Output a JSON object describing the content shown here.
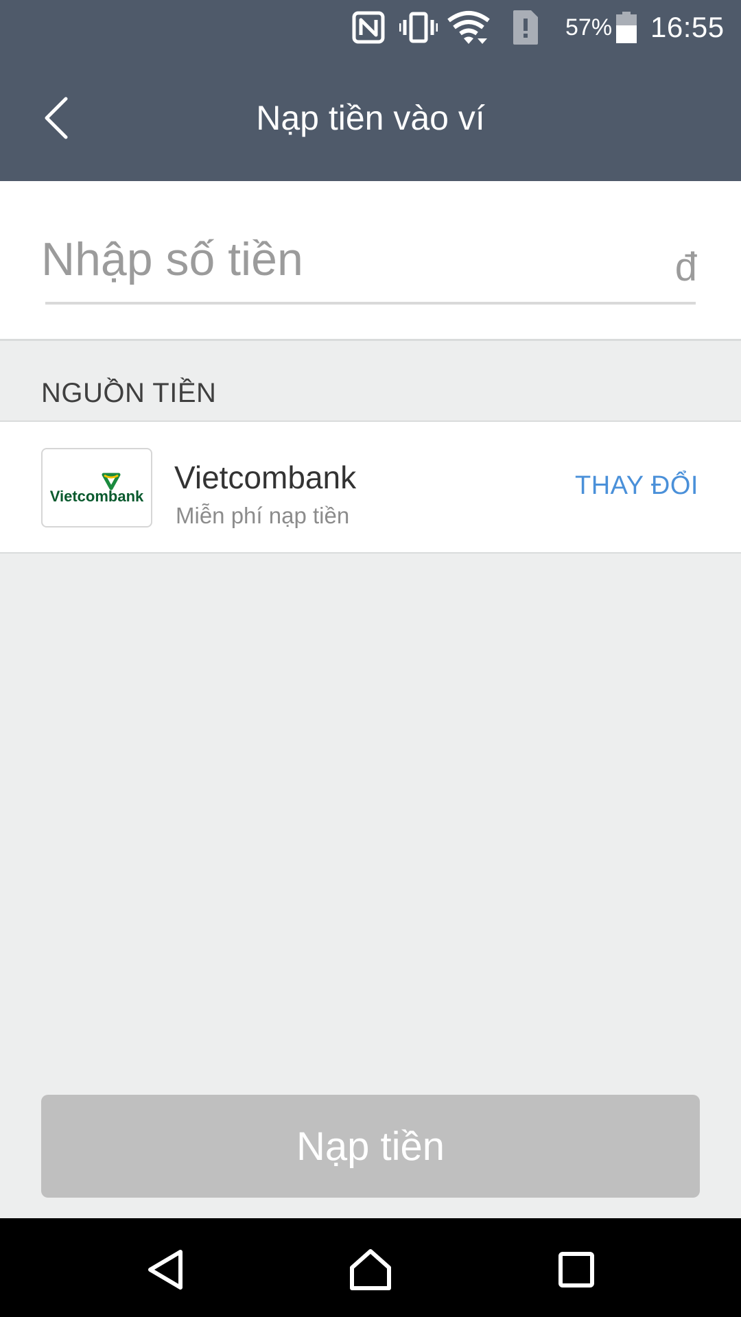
{
  "status_bar": {
    "battery_percent": "57%",
    "time": "16:55",
    "icons": [
      "nfc-icon",
      "vibrate-icon",
      "wifi-icon",
      "sim-alert-icon",
      "battery-icon"
    ]
  },
  "app_bar": {
    "title": "Nạp tiền vào ví",
    "back_icon": "chevron-left-icon"
  },
  "amount": {
    "placeholder": "Nhập số tiền",
    "value": "",
    "currency": "đ"
  },
  "source": {
    "header": "NGUỒN TIỀN",
    "bank_logo_text": "Vietcombank",
    "bank_name": "Vietcombank",
    "subtitle": "Miễn phí nạp tiền",
    "change_label": "THAY ĐỔI"
  },
  "primary_button": {
    "label": "Nạp tiền",
    "enabled": false
  },
  "nav_bar": {
    "icons": [
      "nav-back-icon",
      "nav-home-icon",
      "nav-recents-icon"
    ]
  },
  "colors": {
    "header_bg": "#4f5a6a",
    "page_bg": "#edeeee",
    "accent": "#4a90d9",
    "disabled_button": "#bfbfbf",
    "brand_green": "#0a6b3a"
  }
}
